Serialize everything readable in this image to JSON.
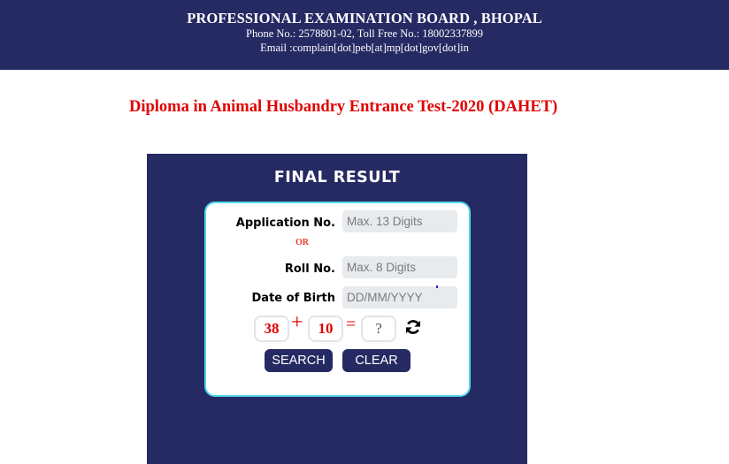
{
  "header": {
    "title": "PROFESSIONAL EXAMINATION BOARD , BHOPAL",
    "phone": "Phone No.: 2578801-02, Toll Free No.: 18002337899",
    "email": "Email :complain[dot]peb[at]mp[dot]gov[dot]in"
  },
  "exam_title": "Diploma in Animal Husbandry Entrance Test-2020 (DAHET)",
  "panel": {
    "title": "FINAL RESULT"
  },
  "form": {
    "application_label": "Application No.",
    "application_placeholder": "Max. 13 Digits",
    "or_text": "OR",
    "roll_label": "Roll No.",
    "roll_placeholder": "Max. 8 Digits",
    "dob_label": "Date of Birth",
    "dob_placeholder": "DD/MM/YYYY"
  },
  "captcha": {
    "num1": "38",
    "operator": "+",
    "num2": "10",
    "equals": "=",
    "answer_placeholder": "?",
    "refresh_icon": "refresh-icon"
  },
  "buttons": {
    "search": "SEARCH",
    "clear": "CLEAR"
  },
  "colors": {
    "navy": "#262a63",
    "title_red": "#e10000",
    "card_border": "#4fd7ec"
  }
}
